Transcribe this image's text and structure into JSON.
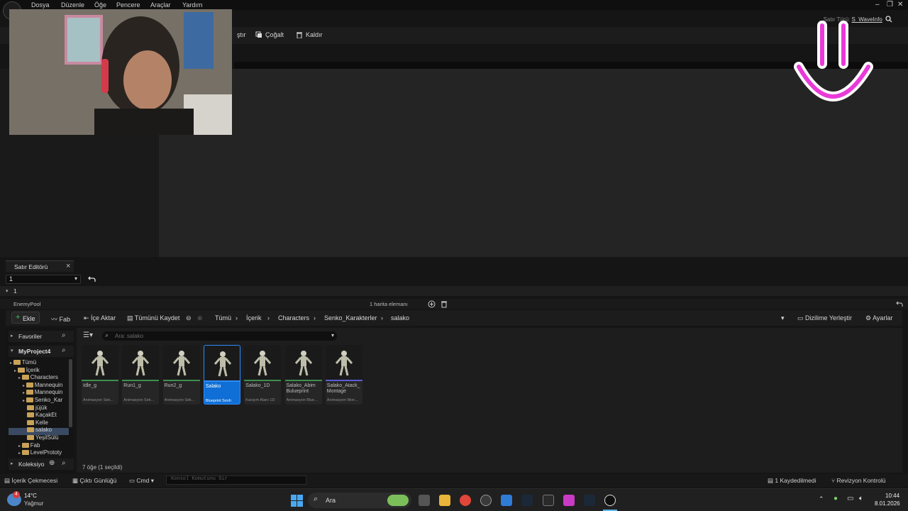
{
  "menu": [
    "Dosya",
    "Düzenle",
    "Öğe",
    "Pencere",
    "Araçlar",
    "Yardım"
  ],
  "window_controls": [
    "–",
    "❐",
    "✕"
  ],
  "toolbar": {
    "partial_label": "ştır",
    "duplicate_label": "Çoğalt",
    "remove_label": "Kaldır"
  },
  "row_type": {
    "label": "Satır Türü:",
    "value": "S_WaveInfo"
  },
  "row_editor": {
    "tab_label": "Satır Editörü",
    "close": "×",
    "selected_row": "1",
    "row_name": "1"
  },
  "pool": {
    "name": "EnemyPool",
    "map_count": "1 harita elemanı"
  },
  "content_browser": {
    "add_label": "Ekle",
    "fab_label": "Fab",
    "import_label": "İçe Aktar",
    "save_all_label": "Tümünü Kaydet",
    "breadcrumbs": [
      "Tümü",
      "İçerik",
      "Characters",
      "Senko_Karakterler",
      "salako"
    ],
    "dock_label": "Dizilime Yerleştir",
    "settings_label": "Ayarlar",
    "search_placeholder": "Ara: salako",
    "favorites_label": "Favoriler",
    "project_label": "MyProject4",
    "collections_label": "Koleksiyo",
    "tree": [
      {
        "label": "Tümü",
        "level": 0
      },
      {
        "label": "İçerik",
        "level": 1
      },
      {
        "label": "Characters",
        "level": 2
      },
      {
        "label": "Mannequin",
        "level": 3
      },
      {
        "label": "Mannequin",
        "level": 3
      },
      {
        "label": "Senko_Kar",
        "level": 3
      },
      {
        "label": "jüjük",
        "level": 4
      },
      {
        "label": "KaçakEt",
        "level": 4
      },
      {
        "label": "Kelle",
        "level": 4
      },
      {
        "label": "salako",
        "level": 4
      },
      {
        "label": "YeşilSülü",
        "level": 4
      },
      {
        "label": "Fab",
        "level": 2
      },
      {
        "label": "LevelPrototy",
        "level": 2
      }
    ],
    "assets": [
      {
        "name": "Idle_g",
        "type": "Animasyon Sek...",
        "color": "#3c8f4c",
        "selected": false
      },
      {
        "name": "Run1_g",
        "type": "Animasyon Sek...",
        "color": "#3c8f4c",
        "selected": false
      },
      {
        "name": "Run2_g",
        "type": "Animasyon Sek...",
        "color": "#3c8f4c",
        "selected": false
      },
      {
        "name": "Salako",
        "type": "Blueprint Sınıfı",
        "color": "#2d8cff",
        "selected": true
      },
      {
        "name": "Salako_1D",
        "type": "Karışım Alanı 1D",
        "color": "#3c8f4c",
        "selected": false
      },
      {
        "name": "Salako_Abim Bulueprint",
        "type": "Animasyon Blue...",
        "color": "#3c8f4c",
        "selected": false
      },
      {
        "name": "Salako_Atack_ Montage",
        "type": "Animasyon Mon...",
        "color": "#5b5bd6",
        "selected": false
      }
    ],
    "item_count": "7 öğe (1 seçildi)"
  },
  "statusbar": {
    "drawer": "İçerik Çekmecesi",
    "output": "Çıktı Günlüğü",
    "cmd": "Cmd",
    "console_placeholder": "Konsol Komutunu Gir",
    "unsaved": "1 Kaydedilmedi",
    "revision": "Revizyon Kontrolü"
  },
  "taskbar": {
    "temp": "14°C",
    "weather": "Yağmur",
    "search": "Ara",
    "time": "10:44",
    "date": "8.01.2026",
    "badge": "4"
  }
}
